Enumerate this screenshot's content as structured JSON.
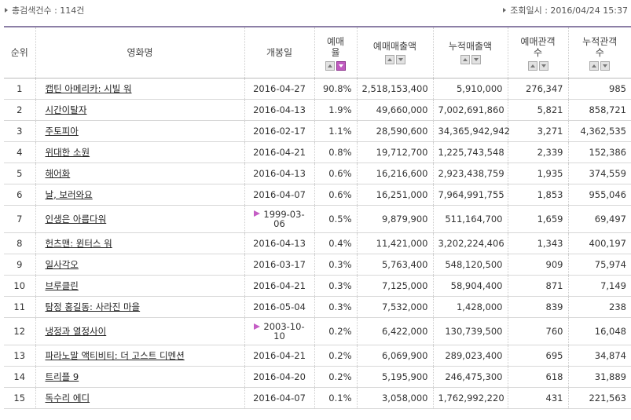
{
  "summary": {
    "total_label": "총검색건수 : 114건"
  },
  "query": {
    "datetime_label": "조회일시 : 2016/04/24 15:37"
  },
  "columns": {
    "rank": "순위",
    "title": "영화명",
    "release": "개봉일",
    "share_l1": "예매",
    "share_l2": "율",
    "sales": "예매매출액",
    "cum_sales": "누적매출액",
    "audience_l1": "예매관객",
    "audience_l2": "수",
    "cum_audience_l1": "누적관객",
    "cum_audience_l2": "수"
  },
  "rows": [
    {
      "rank": "1",
      "title": "캡틴 아메리카: 시빌 워",
      "date": "2016-04-27",
      "share": "90.8%",
      "sales": "2,518,153,400",
      "cum_sales": "5,910,000",
      "audience": "276,347",
      "cum_audience": "985"
    },
    {
      "rank": "2",
      "title": "시간이탈자",
      "date": "2016-04-13",
      "share": "1.9%",
      "sales": "49,660,000",
      "cum_sales": "7,002,691,860",
      "audience": "5,821",
      "cum_audience": "858,721"
    },
    {
      "rank": "3",
      "title": "주토피아",
      "date": "2016-02-17",
      "share": "1.1%",
      "sales": "28,590,600",
      "cum_sales": "34,365,942,942",
      "audience": "3,271",
      "cum_audience": "4,362,535"
    },
    {
      "rank": "4",
      "title": "위대한 소원",
      "date": "2016-04-21",
      "share": "0.8%",
      "sales": "19,712,700",
      "cum_sales": "1,225,743,548",
      "audience": "2,339",
      "cum_audience": "152,386"
    },
    {
      "rank": "5",
      "title": "해어화",
      "date": "2016-04-13",
      "share": "0.6%",
      "sales": "16,216,600",
      "cum_sales": "2,923,438,759",
      "audience": "1,935",
      "cum_audience": "374,559"
    },
    {
      "rank": "6",
      "title": "날, 보러와요",
      "date": "2016-04-07",
      "share": "0.6%",
      "sales": "16,251,000",
      "cum_sales": "7,964,991,755",
      "audience": "1,853",
      "cum_audience": "955,046"
    },
    {
      "rank": "7",
      "title": "인생은 아름다워",
      "date_l1": "1999-03-",
      "date_l2": "06",
      "share": "0.5%",
      "sales": "9,879,900",
      "cum_sales": "511,164,700",
      "audience": "1,659",
      "cum_audience": "69,497"
    },
    {
      "rank": "8",
      "title": "헌츠맨: 윈터스 워",
      "date": "2016-04-13",
      "share": "0.4%",
      "sales": "11,421,000",
      "cum_sales": "3,202,224,406",
      "audience": "1,343",
      "cum_audience": "400,197"
    },
    {
      "rank": "9",
      "title": "일사각오",
      "date": "2016-03-17",
      "share": "0.3%",
      "sales": "5,763,400",
      "cum_sales": "548,120,500",
      "audience": "909",
      "cum_audience": "75,974"
    },
    {
      "rank": "10",
      "title": "브루클린",
      "date": "2016-04-21",
      "share": "0.3%",
      "sales": "7,125,000",
      "cum_sales": "58,904,400",
      "audience": "871",
      "cum_audience": "7,149"
    },
    {
      "rank": "11",
      "title": "탐정 홍길동: 사라진 마을",
      "date": "2016-05-04",
      "share": "0.3%",
      "sales": "7,532,000",
      "cum_sales": "1,428,000",
      "audience": "839",
      "cum_audience": "238"
    },
    {
      "rank": "12",
      "title": "냉정과 열정사이",
      "date_l1": "2003-10-",
      "date_l2": "10",
      "share": "0.2%",
      "sales": "6,422,000",
      "cum_sales": "130,739,500",
      "audience": "760",
      "cum_audience": "16,048"
    },
    {
      "rank": "13",
      "title": "파라노말 액티비티: 더 고스트 디멘션",
      "date": "2016-04-21",
      "share": "0.2%",
      "sales": "6,069,900",
      "cum_sales": "289,023,400",
      "audience": "695",
      "cum_audience": "34,874"
    },
    {
      "rank": "14",
      "title": "트리플 9",
      "date": "2016-04-20",
      "share": "0.2%",
      "sales": "5,195,900",
      "cum_sales": "246,475,300",
      "audience": "618",
      "cum_audience": "31,889"
    },
    {
      "rank": "15",
      "title": "독수리 에디",
      "date": "2016-04-07",
      "share": "0.1%",
      "sales": "3,058,000",
      "cum_sales": "1,762,992,220",
      "audience": "431",
      "cum_audience": "221,563"
    }
  ]
}
